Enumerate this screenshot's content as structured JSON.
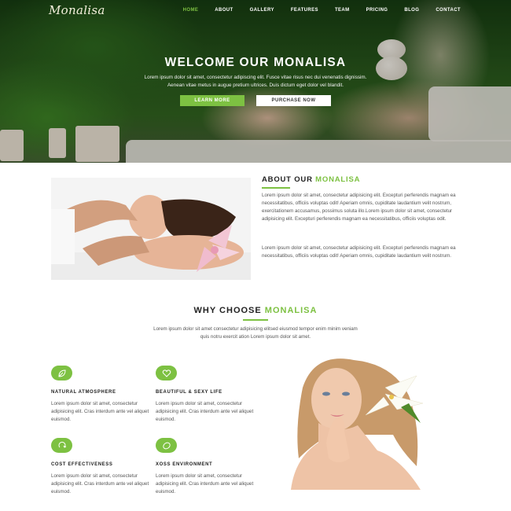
{
  "brand": {
    "logo": "Monalisa",
    "accent": "#7dc142"
  },
  "nav": {
    "items": [
      {
        "label": "HOME",
        "active": true
      },
      {
        "label": "ABOUT",
        "active": false
      },
      {
        "label": "GALLERY",
        "active": false
      },
      {
        "label": "FEATURES",
        "active": false
      },
      {
        "label": "TEAM",
        "active": false
      },
      {
        "label": "PRICING",
        "active": false
      },
      {
        "label": "BLOG",
        "active": false
      },
      {
        "label": "CONTACT",
        "active": false
      }
    ]
  },
  "hero": {
    "title": "WELCOME OUR MONALISA",
    "text_line1": "Lorem ipsum dolor sit amet, consectetur adipiscing elit. Fusce vitae risus nec dui venenatis dignissim.",
    "text_line2": "Aenean vitae metus in augue pretium ultrices. Duis dictum eget dolor vel blandit.",
    "btn_learn": "LEARN MORE",
    "btn_purchase": "PURCHASE NOW"
  },
  "about": {
    "title_prefix": "ABOUT OUR ",
    "title_highlight": "MONALISA",
    "para1": "Lorem ipsum dolor sit amet, consectetur adipisicing elit. Excepturi perferendis magnam ea necessitatibus, officiis voluptas odit! Aperiam omnis, cupiditate laudantium velit nostrum, exercitationem accusamus, possimus soluta illo.Lorem ipsum dolor sit amet, consectetur adipisicing elit. Excepturi perferendis magnam ea necessitatibus, officiis voluptas odit.",
    "para2": "Lorem ipsum dolor sit amet, consectetur adipisicing elit. Excepturi perferendis magnam ea necessitatibus, officiis voluptas odit! Aperiam omnis, cupiditate laudantium velit nostrum."
  },
  "why": {
    "title_prefix": "WHY CHOOSE ",
    "title_highlight": "MONALISA",
    "text_line1": "Lorem ipsum dolor sit amet consectetur adipisicing elitsed eiusmod tempor enim minim veniam",
    "text_line2": "quis notru exercit ation Lorem ipsum dolor sit amet.",
    "features": [
      {
        "icon": "leaf-icon",
        "title": "NATURAL ATMOSPHERE",
        "text": "Lorem ipsum dolor sit amet, consectetur adipisicing elit. Cras interdum ante vel aliquet euismod."
      },
      {
        "icon": "heart-icon",
        "title": "BEAUTIFUL & SEXY LIFE",
        "text": "Lorem ipsum dolor sit amet, consectetur adipisicing elit. Cras interdum ante vel aliquet euismod."
      },
      {
        "icon": "recycle-icon",
        "title": "COST EFFECTIVENESS",
        "text": "Lorem ipsum dolor sit amet, consectetur adipisicing elit. Cras interdum ante vel aliquet euismod."
      },
      {
        "icon": "lemon-icon",
        "title": "XOSS ENVIRONMENT",
        "text": "Lorem ipsum dolor sit amet, consectetur adipisicing elit. Cras interdum ante vel aliquet euismod."
      }
    ]
  }
}
